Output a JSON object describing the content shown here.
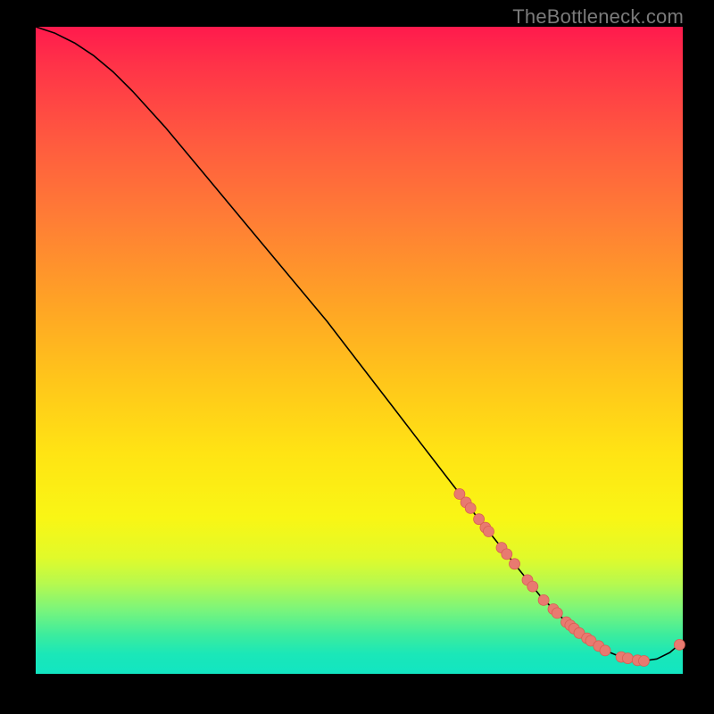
{
  "watermark": "TheBottleneck.com",
  "colors": {
    "dot_fill": "#e87a70",
    "dot_stroke": "#d85e53",
    "line": "#000000"
  },
  "chart_data": {
    "type": "line",
    "title": "",
    "xlabel": "",
    "ylabel": "",
    "xlim": [
      0,
      100
    ],
    "ylim": [
      0,
      100
    ],
    "grid": false,
    "series": [
      {
        "name": "curve",
        "x": [
          0,
          3,
          6,
          9,
          12,
          15,
          20,
          25,
          30,
          35,
          40,
          45,
          50,
          55,
          60,
          65,
          68,
          70,
          72,
          74,
          76,
          78,
          80,
          82,
          84,
          86,
          88,
          90,
          92,
          94,
          96,
          98,
          100
        ],
        "y": [
          100,
          99,
          97.5,
          95.5,
          93,
          90,
          84.5,
          78.5,
          72.5,
          66.5,
          60.5,
          54.5,
          48,
          41.5,
          35,
          28.5,
          24.5,
          22,
          19.5,
          17,
          14.5,
          12,
          10,
          8,
          6.3,
          4.8,
          3.6,
          2.8,
          2.3,
          2,
          2.3,
          3.3,
          5
        ]
      }
    ],
    "scatter": {
      "name": "markers",
      "x": [
        65.5,
        66.5,
        67.2,
        68.5,
        69.5,
        70.0,
        72.0,
        72.8,
        74.0,
        76.0,
        76.8,
        78.5,
        80.0,
        80.6,
        82.0,
        82.6,
        83.2,
        84.0,
        85.2,
        85.8,
        87.0,
        88.0,
        90.5,
        91.5,
        93.0,
        94.0,
        99.5
      ],
      "y": [
        27.8,
        26.5,
        25.6,
        23.9,
        22.6,
        22.0,
        19.5,
        18.5,
        17.0,
        14.5,
        13.5,
        11.4,
        10.0,
        9.4,
        8.0,
        7.5,
        7.0,
        6.3,
        5.5,
        5.1,
        4.3,
        3.6,
        2.6,
        2.4,
        2.1,
        2.0,
        4.5
      ]
    }
  }
}
